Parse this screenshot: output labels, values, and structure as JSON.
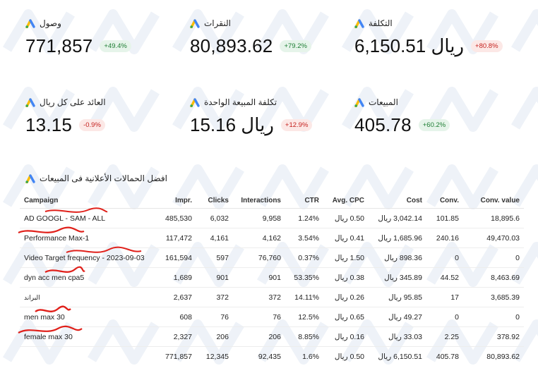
{
  "kpis": [
    {
      "label": "وصول",
      "value": "771,857",
      "change": "+49.4%",
      "trend": "up"
    },
    {
      "label": "النقرات",
      "value": "80,893.62",
      "change": "+79.2%",
      "trend": "up"
    },
    {
      "label": "التكلفة",
      "value": "6,150.51 ريال",
      "change": "+80.8%",
      "trend": "down"
    },
    {
      "label": "العائد على كل ريال",
      "value": "13.15",
      "change": "-0.9%",
      "trend": "down"
    },
    {
      "label": "تكلفة المبيعة الواحدة",
      "value": "15.16 ريال",
      "change": "+12.9%",
      "trend": "down"
    },
    {
      "label": "المبيعات",
      "value": "405.78",
      "change": "+60.2%",
      "trend": "up"
    }
  ],
  "table": {
    "title": "افضل الحمالات الأعلانية فى المبيعات",
    "headers": [
      "Campaign",
      "Impr.",
      "Clicks",
      "Interactions",
      "CTR",
      "Avg. CPC",
      "Cost",
      "Conv.",
      "Conv. value"
    ],
    "rows": [
      [
        "AD GOOGL - SAM - ALL",
        "485,530",
        "6,032",
        "9,958",
        "1.24%",
        "0.50 ريال",
        "3,042.14 ريال",
        "101.85",
        "18,895.6"
      ],
      [
        "Performance Max-1",
        "117,472",
        "4,161",
        "4,162",
        "3.54%",
        "0.41 ريال",
        "1,685.96 ريال",
        "240.16",
        "49,470.03"
      ],
      [
        "Video Target frequency - 2023-09-03",
        "161,594",
        "597",
        "76,760",
        "0.37%",
        "1.50 ريال",
        "898.36 ريال",
        "0",
        "0"
      ],
      [
        "dyn acc men cpa5",
        "1,689",
        "901",
        "901",
        "53.35%",
        "0.38 ريال",
        "345.89 ريال",
        "44.52",
        "8,463.69"
      ],
      [
        "البراند",
        "2,637",
        "372",
        "372",
        "14.11%",
        "0.26 ريال",
        "95.85 ريال",
        "17",
        "3,685.39"
      ],
      [
        "men max 30",
        "608",
        "76",
        "76",
        "12.5%",
        "0.65 ريال",
        "49.27 ريال",
        "0",
        "0"
      ],
      [
        "female max 30",
        "2,327",
        "206",
        "206",
        "8.85%",
        "0.16 ريال",
        "33.03 ريال",
        "2.25",
        "378.92"
      ]
    ],
    "totals": [
      "",
      "771,857",
      "12,345",
      "92,435",
      "1.6%",
      "0.50 ريال",
      "6,150.51 ريال",
      "405.78",
      "80,893.62"
    ]
  },
  "colors": {
    "badge_up_bg": "#e6f4ea",
    "badge_up_text": "#1e7e34",
    "badge_down_bg": "#fce8e6",
    "badge_down_text": "#c5221f",
    "scribble": "#e0201a"
  },
  "icons": {
    "kpi_icon": "google-ads-icon",
    "title_icon": "google-ads-icon"
  }
}
